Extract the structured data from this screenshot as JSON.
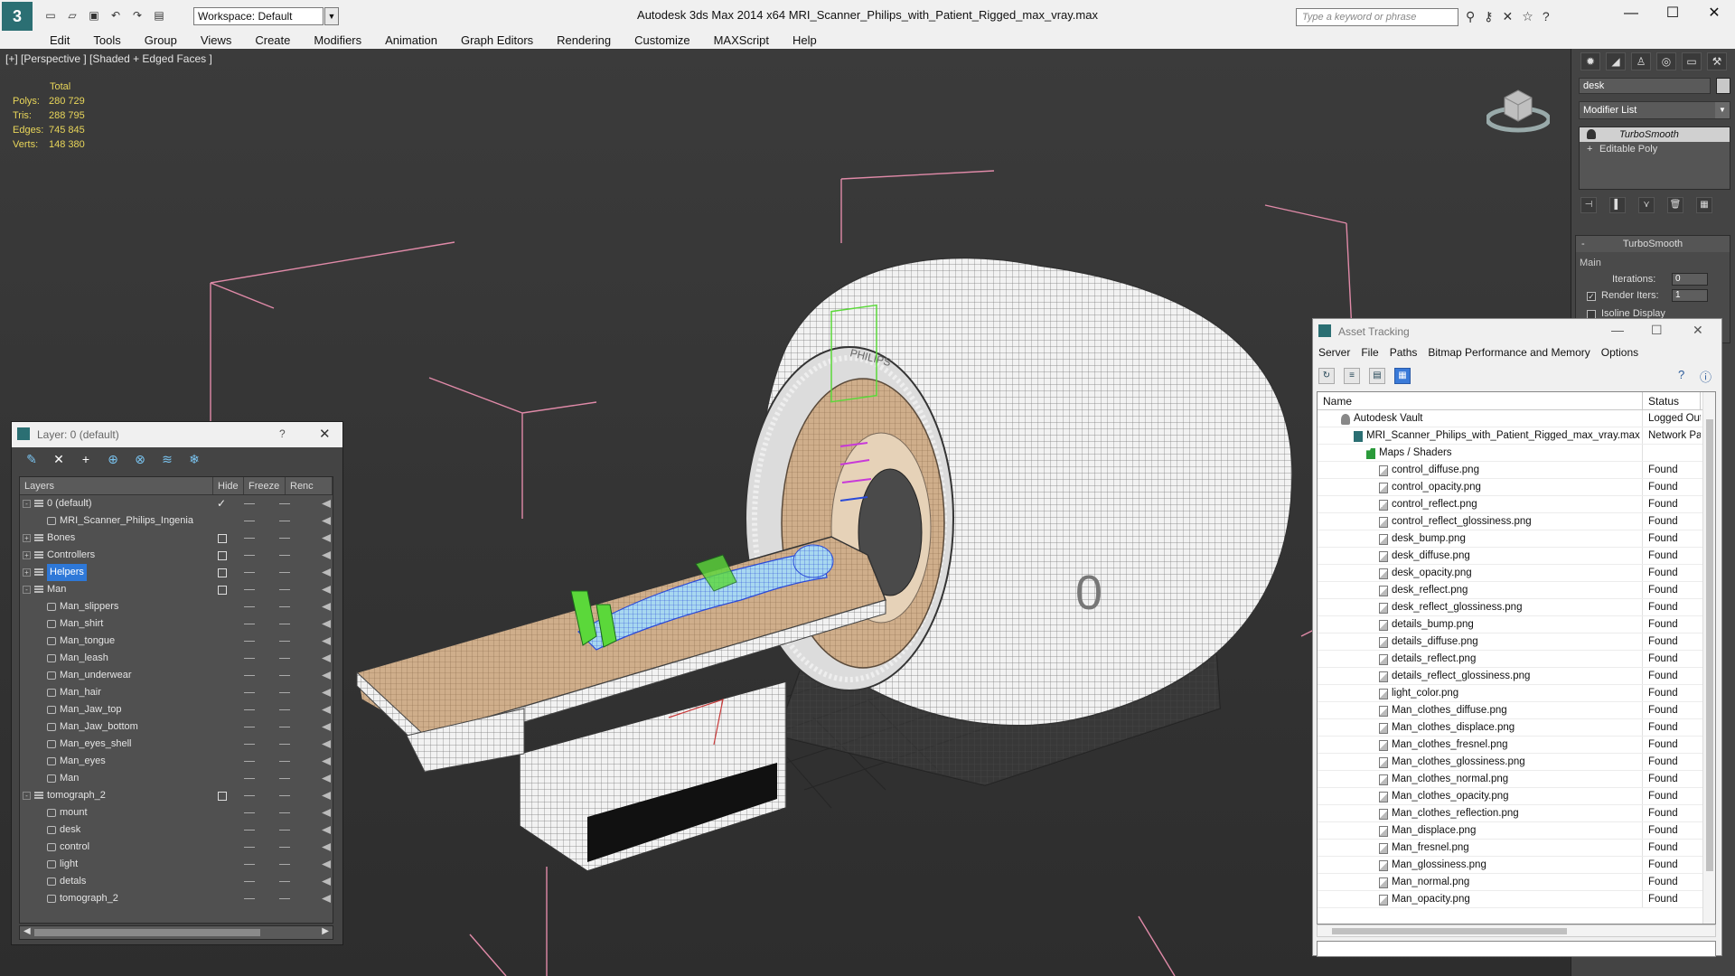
{
  "app": {
    "title": "Autodesk 3ds Max  2014 x64     MRI_Scanner_Philips_with_Patient_Rigged_max_vray.max",
    "logo": "3",
    "workspace": "Workspace: Default",
    "search_placeholder": "Type a keyword or phrase"
  },
  "menu": [
    "Edit",
    "Tools",
    "Group",
    "Views",
    "Create",
    "Modifiers",
    "Animation",
    "Graph Editors",
    "Rendering",
    "Customize",
    "MAXScript",
    "Help"
  ],
  "viewport": {
    "label": "[+] [Perspective ] [Shaded + Edged Faces ]",
    "stats": {
      "header": "Total",
      "rows": [
        {
          "k": "Polys:",
          "v": "280 729"
        },
        {
          "k": "Tris:",
          "v": "288 795"
        },
        {
          "k": "Edges:",
          "v": "745 845"
        },
        {
          "k": "Verts:",
          "v": "148 380"
        }
      ]
    },
    "brand_text": "PHILIPS"
  },
  "command_panel": {
    "object_name": "desk",
    "modifier_list": "Modifier List",
    "stack": [
      "TurboSmooth",
      "Editable Poly"
    ],
    "rollout": {
      "title": "TurboSmooth",
      "group": "Main",
      "iterations_label": "Iterations:",
      "iterations_value": "0",
      "render_iters_label": "Render Iters:",
      "render_iters_value": "1",
      "isoline_label": "Isoline Display"
    }
  },
  "layer_window": {
    "title": "Layer: 0 (default)",
    "help": "?",
    "columns": [
      "Layers",
      "Hide",
      "Freeze",
      "Renc"
    ],
    "rows": [
      {
        "name": "0 (default)",
        "level": 0,
        "type": "layer",
        "expand": "-",
        "current": true
      },
      {
        "name": "MRI_Scanner_Philips_Ingenia",
        "level": 1,
        "type": "obj"
      },
      {
        "name": "Bones",
        "level": 0,
        "type": "layer",
        "expand": "+",
        "box": true
      },
      {
        "name": "Controllers",
        "level": 0,
        "type": "layer",
        "expand": "+",
        "box": true
      },
      {
        "name": "Helpers",
        "level": 0,
        "type": "layer",
        "expand": "+",
        "box": true,
        "selected": true
      },
      {
        "name": "Man",
        "level": 0,
        "type": "layer",
        "expand": "-",
        "box": true
      },
      {
        "name": "Man_slippers",
        "level": 1,
        "type": "obj"
      },
      {
        "name": "Man_shirt",
        "level": 1,
        "type": "obj"
      },
      {
        "name": "Man_tongue",
        "level": 1,
        "type": "obj"
      },
      {
        "name": "Man_leash",
        "level": 1,
        "type": "obj"
      },
      {
        "name": "Man_underwear",
        "level": 1,
        "type": "obj"
      },
      {
        "name": "Man_hair",
        "level": 1,
        "type": "obj"
      },
      {
        "name": "Man_Jaw_top",
        "level": 1,
        "type": "obj"
      },
      {
        "name": "Man_Jaw_bottom",
        "level": 1,
        "type": "obj"
      },
      {
        "name": "Man_eyes_shell",
        "level": 1,
        "type": "obj"
      },
      {
        "name": "Man_eyes",
        "level": 1,
        "type": "obj"
      },
      {
        "name": "Man",
        "level": 1,
        "type": "obj"
      },
      {
        "name": "tomograph_2",
        "level": 0,
        "type": "layer",
        "expand": "-",
        "box": true
      },
      {
        "name": "mount",
        "level": 1,
        "type": "obj"
      },
      {
        "name": "desk",
        "level": 1,
        "type": "obj"
      },
      {
        "name": "control",
        "level": 1,
        "type": "obj"
      },
      {
        "name": "light",
        "level": 1,
        "type": "obj"
      },
      {
        "name": "detals",
        "level": 1,
        "type": "obj"
      },
      {
        "name": "tomograph_2",
        "level": 1,
        "type": "obj"
      }
    ]
  },
  "asset_window": {
    "title": "Asset Tracking",
    "menu": [
      "Server",
      "File",
      "Paths",
      "Bitmap Performance and Memory",
      "Options"
    ],
    "columns": [
      "Name",
      "Status"
    ],
    "rows": [
      {
        "name": "Autodesk Vault",
        "status": "Logged Out",
        "level": 0,
        "icon": "vault"
      },
      {
        "name": "MRI_Scanner_Philips_with_Patient_Rigged_max_vray.max",
        "status": "Network Path",
        "level": 1,
        "icon": "maxf"
      },
      {
        "name": "Maps / Shaders",
        "status": "",
        "level": 2,
        "icon": "folder"
      },
      {
        "name": "control_diffuse.png",
        "status": "Found",
        "level": 3,
        "icon": "img"
      },
      {
        "name": "control_opacity.png",
        "status": "Found",
        "level": 3,
        "icon": "img"
      },
      {
        "name": "control_reflect.png",
        "status": "Found",
        "level": 3,
        "icon": "img"
      },
      {
        "name": "control_reflect_glossiness.png",
        "status": "Found",
        "level": 3,
        "icon": "img"
      },
      {
        "name": "desk_bump.png",
        "status": "Found",
        "level": 3,
        "icon": "img"
      },
      {
        "name": "desk_diffuse.png",
        "status": "Found",
        "level": 3,
        "icon": "img"
      },
      {
        "name": "desk_opacity.png",
        "status": "Found",
        "level": 3,
        "icon": "img"
      },
      {
        "name": "desk_reflect.png",
        "status": "Found",
        "level": 3,
        "icon": "img"
      },
      {
        "name": "desk_reflect_glossiness.png",
        "status": "Found",
        "level": 3,
        "icon": "img"
      },
      {
        "name": "details_bump.png",
        "status": "Found",
        "level": 3,
        "icon": "img"
      },
      {
        "name": "details_diffuse.png",
        "status": "Found",
        "level": 3,
        "icon": "img"
      },
      {
        "name": "details_reflect.png",
        "status": "Found",
        "level": 3,
        "icon": "img"
      },
      {
        "name": "details_reflect_glossiness.png",
        "status": "Found",
        "level": 3,
        "icon": "img"
      },
      {
        "name": "light_color.png",
        "status": "Found",
        "level": 3,
        "icon": "img"
      },
      {
        "name": "Man_clothes_diffuse.png",
        "status": "Found",
        "level": 3,
        "icon": "img"
      },
      {
        "name": "Man_clothes_displace.png",
        "status": "Found",
        "level": 3,
        "icon": "img"
      },
      {
        "name": "Man_clothes_fresnel.png",
        "status": "Found",
        "level": 3,
        "icon": "img"
      },
      {
        "name": "Man_clothes_glossiness.png",
        "status": "Found",
        "level": 3,
        "icon": "img"
      },
      {
        "name": "Man_clothes_normal.png",
        "status": "Found",
        "level": 3,
        "icon": "img"
      },
      {
        "name": "Man_clothes_opacity.png",
        "status": "Found",
        "level": 3,
        "icon": "img"
      },
      {
        "name": "Man_clothes_reflection.png",
        "status": "Found",
        "level": 3,
        "icon": "img"
      },
      {
        "name": "Man_displace.png",
        "status": "Found",
        "level": 3,
        "icon": "img"
      },
      {
        "name": "Man_fresnel.png",
        "status": "Found",
        "level": 3,
        "icon": "img"
      },
      {
        "name": "Man_glossiness.png",
        "status": "Found",
        "level": 3,
        "icon": "img"
      },
      {
        "name": "Man_normal.png",
        "status": "Found",
        "level": 3,
        "icon": "img"
      },
      {
        "name": "Man_opacity.png",
        "status": "Found",
        "level": 3,
        "icon": "img"
      }
    ]
  },
  "colors": {
    "accent": "#2e78d8",
    "stats_text": "#e9d65a",
    "app_logo": "#2b6f73",
    "viewport_bg": "#333333",
    "bbox_lines": "#e08aa8"
  }
}
